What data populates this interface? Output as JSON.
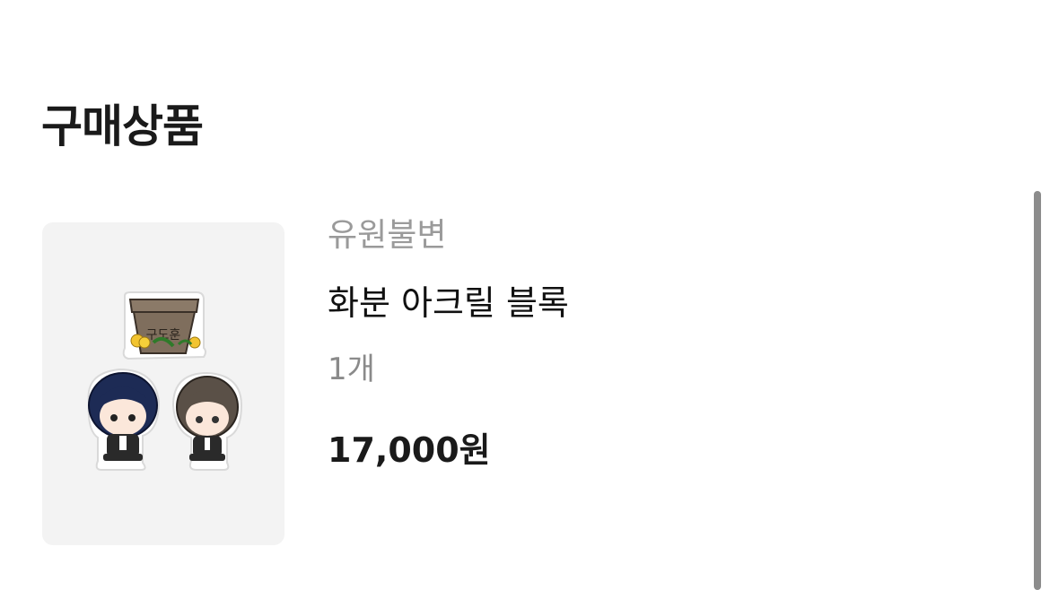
{
  "section": {
    "title": "구매상품"
  },
  "product": {
    "brand": "유원불변",
    "name": "화분 아크릴 블록",
    "quantity": "1개",
    "price": "17,000원",
    "image_icon": "acrylic-block-product-image"
  },
  "colors": {
    "thumb_background": "#f3f3f3",
    "brand_text": "#9a9a9a",
    "quantity_text": "#8a8a8a",
    "title_text": "#1a1a1a"
  }
}
